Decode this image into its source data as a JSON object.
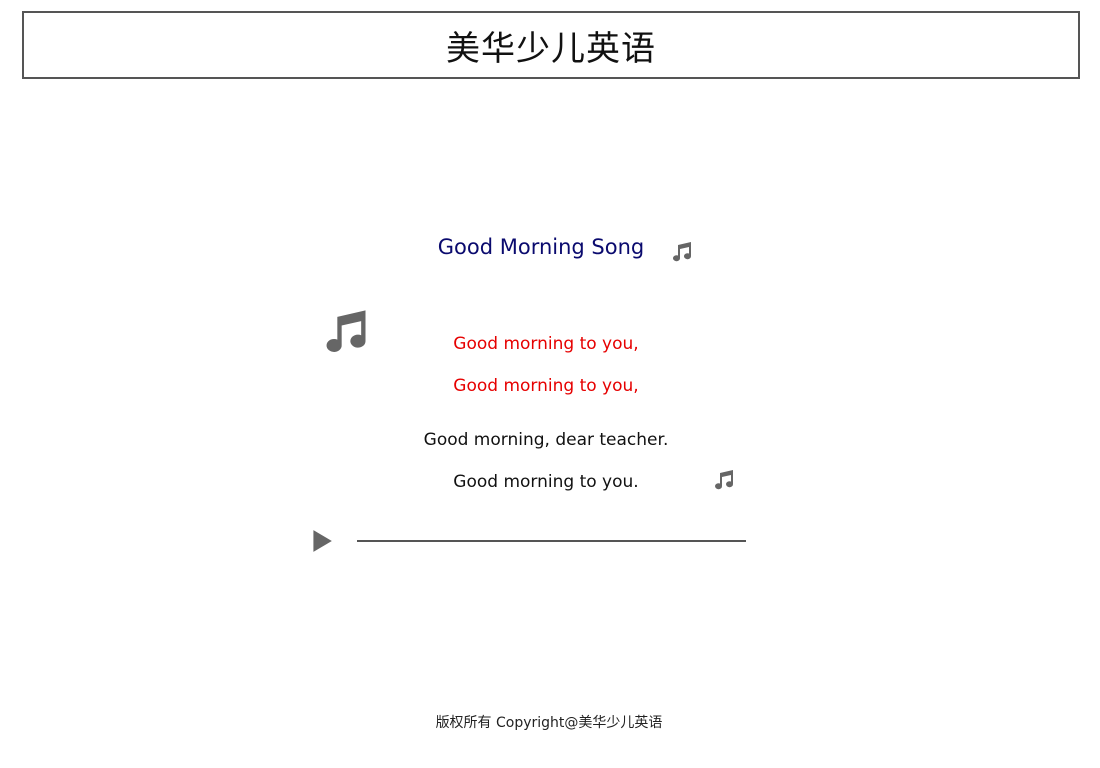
{
  "header": {
    "title": "美华少儿英语"
  },
  "song": {
    "title": "Good Morning Song",
    "lyrics": [
      {
        "text": "Good morning to you,",
        "color": "#e60000"
      },
      {
        "text": "Good morning to you,",
        "color": "#e60000"
      },
      {
        "text": "Good morning, dear teacher.",
        "color": "#111111"
      },
      {
        "text": "Good morning to you.",
        "color": "#111111"
      }
    ]
  },
  "player": {
    "state": "paused",
    "progress": 0,
    "play_icon": "play-icon"
  },
  "icons": {
    "decor": [
      "music-note-icon",
      "music-note-icon",
      "music-note-icon"
    ],
    "color": "#666666"
  },
  "footer": {
    "copyright": "版权所有 Copyright@美华少儿英语"
  }
}
